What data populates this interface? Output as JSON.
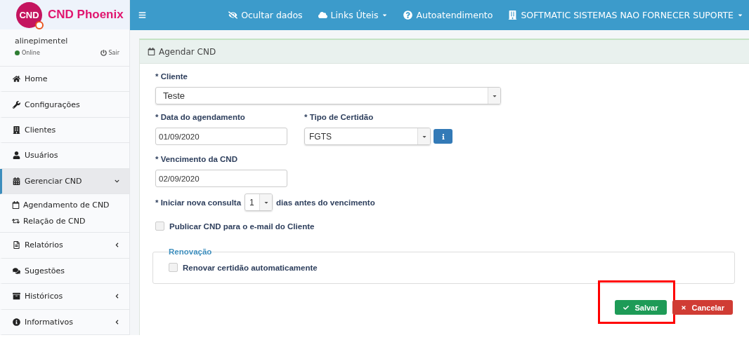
{
  "logo": {
    "badge": "CND",
    "name": "CND Phoenix"
  },
  "user": {
    "name": "alinepimentel",
    "status": "Online",
    "online": true,
    "logout": "Sair"
  },
  "sidebar": {
    "items": [
      {
        "label": "Home",
        "kind": "link",
        "selected": false
      },
      {
        "label": "Configurações",
        "kind": "link",
        "selected": false
      },
      {
        "label": "Clientes",
        "kind": "link",
        "selected": false
      },
      {
        "label": "Usuários",
        "kind": "link",
        "selected": false
      },
      {
        "label": "Gerenciar CND",
        "kind": "group",
        "selected": true,
        "expanded": true,
        "children": [
          {
            "label": "Agendamento de CND"
          },
          {
            "label": "Relação de CND"
          }
        ]
      },
      {
        "label": "Relatórios",
        "kind": "group",
        "selected": false,
        "expanded": false
      },
      {
        "label": "Sugestões",
        "kind": "link",
        "selected": false
      },
      {
        "label": "Históricos",
        "kind": "group",
        "selected": false,
        "expanded": false
      },
      {
        "label": "Informativos",
        "kind": "group",
        "selected": false,
        "expanded": false
      }
    ]
  },
  "topbar": {
    "items": [
      {
        "label": "Ocultar dados",
        "dropdown": false
      },
      {
        "label": "Links Úteis",
        "dropdown": true
      },
      {
        "label": "Autoatendimento",
        "dropdown": false
      },
      {
        "label": "SOFTMATIC SISTEMAS NAO FORNECER SUPORTE",
        "dropdown": true
      }
    ]
  },
  "panel": {
    "title": "Agendar CND",
    "client": {
      "label": "* Cliente",
      "value": "Teste"
    },
    "schedule_date": {
      "label": "* Data do agendamento",
      "value": "01/09/2020"
    },
    "certificate_type": {
      "label": "* Tipo de Certidão",
      "value": "FGTS"
    },
    "due_date": {
      "label": "* Vencimento da CND",
      "value": "02/09/2020"
    },
    "new_query": {
      "prefix": "* Iniciar nova consulta",
      "value": "1",
      "suffix": "dias antes do vencimento"
    },
    "publish": {
      "label": "Publicar CND para o e-mail do Cliente",
      "checked": false
    },
    "renewal": {
      "legend": "Renovação",
      "label": "Renovar certidão automaticamente",
      "checked": false
    },
    "buttons": [
      {
        "label": "Salvar",
        "kind": "save",
        "highlighted": true
      },
      {
        "label": "Cancelar",
        "kind": "cancel",
        "highlighted": false
      }
    ]
  }
}
